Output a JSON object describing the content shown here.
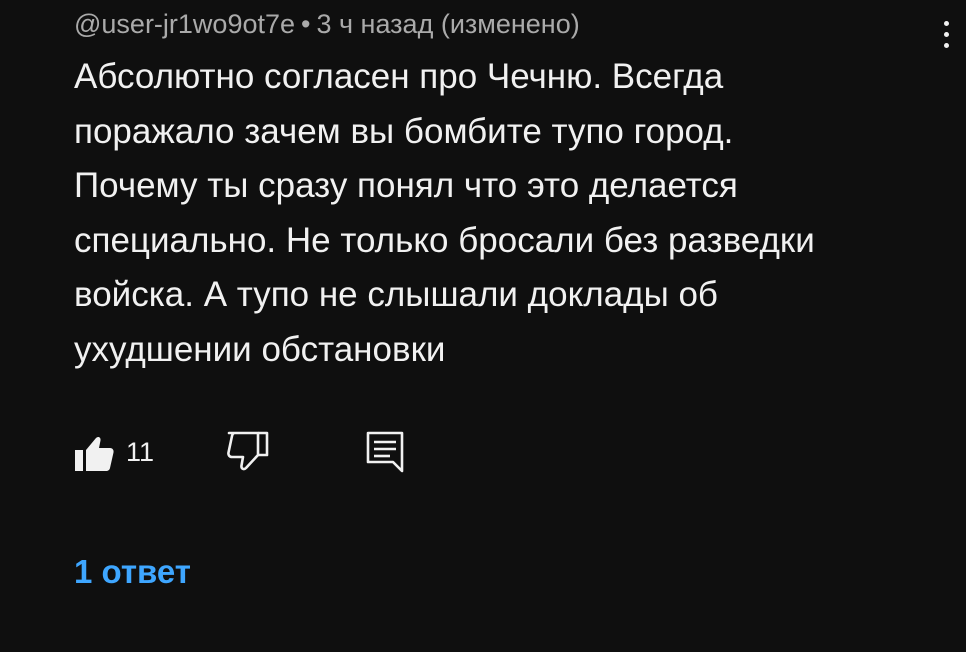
{
  "comment": {
    "author": "@user-jr1wo9ot7e",
    "separator": "•",
    "timestamp": "3 ч назад (изменено)",
    "text_lines": [
      "Абсолютно согласен про Чечню. Всегда",
      "поражало зачем вы бомбите тупо город.",
      "Почему ты сразу понял что это делается",
      "специально. Не только бросали без разведки",
      "войска. А тупо не слышали доклады об",
      "ухудшении обстановки"
    ],
    "like_count": "11",
    "replies_label": "1 ответ"
  },
  "icons": {
    "like": "thumbs-up-filled-icon",
    "dislike": "thumbs-down-outline-icon",
    "reply": "comment-reply-icon",
    "more": "vertical-ellipsis-icon"
  },
  "colors": {
    "background": "#0f0f0f",
    "text": "#f1f1f1",
    "meta_text": "#aaaaaa",
    "link": "#3ea6ff"
  }
}
